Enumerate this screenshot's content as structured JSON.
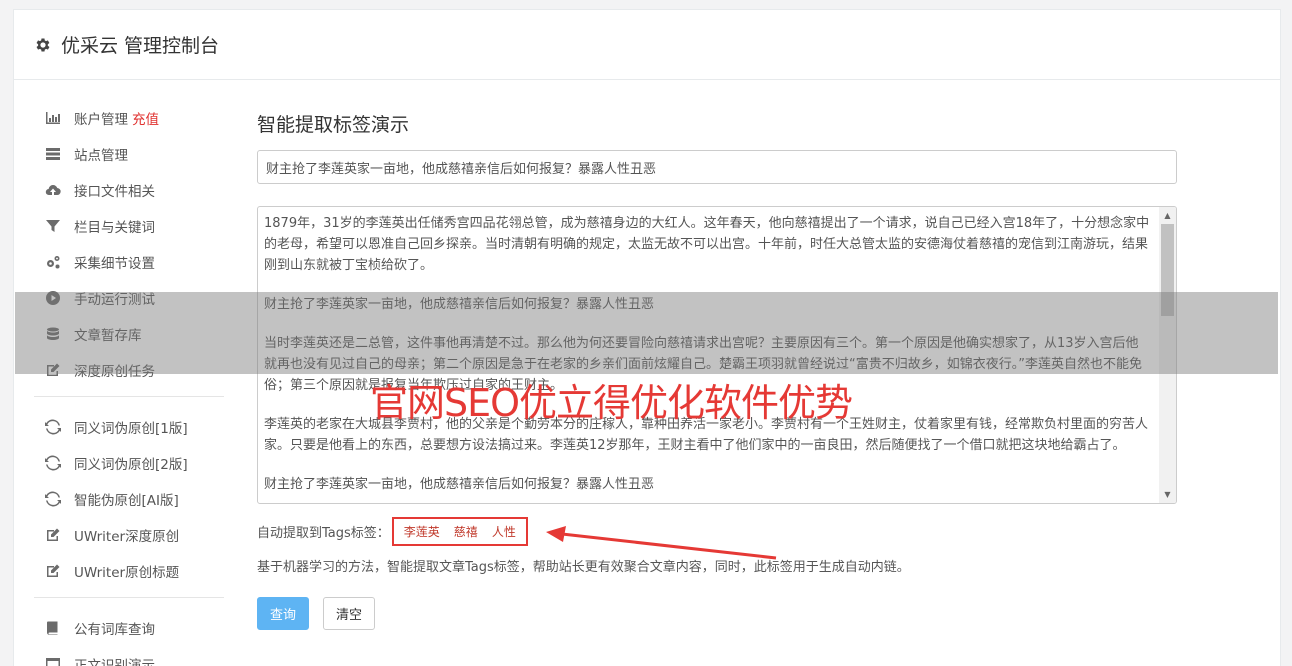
{
  "header": {
    "title": "优采云 管理控制台",
    "icon": "gear-icon"
  },
  "sidebar": {
    "group1": [
      {
        "label": "账户管理",
        "extra": "充值",
        "icon": "bar-chart-icon"
      },
      {
        "label": "站点管理",
        "icon": "server-icon"
      },
      {
        "label": "接口文件相关",
        "icon": "cloud-upload-icon"
      },
      {
        "label": "栏目与关键词",
        "icon": "filter-icon"
      },
      {
        "label": "采集细节设置",
        "icon": "gears-icon"
      },
      {
        "label": "手动运行测试",
        "icon": "play-icon"
      },
      {
        "label": "文章暂存库",
        "icon": "database-icon"
      },
      {
        "label": "深度原创任务",
        "icon": "edit-icon"
      }
    ],
    "group2": [
      {
        "label": "同义词伪原创[1版]",
        "icon": "refresh-icon"
      },
      {
        "label": "同义词伪原创[2版]",
        "icon": "refresh-icon"
      },
      {
        "label": "智能伪原创[AI版]",
        "icon": "refresh-icon"
      },
      {
        "label": "UWriter深度原创",
        "icon": "edit-icon"
      },
      {
        "label": "UWriter原创标题",
        "icon": "edit-icon"
      }
    ],
    "group3": [
      {
        "label": "公有词库查询",
        "icon": "book-icon"
      },
      {
        "label": "正文识别演示",
        "icon": "window-icon"
      }
    ]
  },
  "main": {
    "heading": "智能提取标签演示",
    "title_value": "财主抢了李莲英家一亩地，他成慈禧亲信后如何报复？暴露人性丑恶",
    "content_paragraphs": [
      "1879年，31岁的李莲英出任储秀宫四品花翎总管，成为慈禧身边的大红人。这年春天，他向慈禧提出了一个请求，说自己已经入宫18年了，十分想念家中的老母，希望可以恩准自己回乡探亲。当时清朝有明确的规定，太监无故不可以出宫。十年前，时任大总管太监的安德海仗着慈禧的宠信到江南游玩，结果刚到山东就被丁宝桢给砍了。",
      "财主抢了李莲英家一亩地，他成慈禧亲信后如何报复？暴露人性丑恶",
      "当时李莲英还是二总管，这件事他再清楚不过。那么他为何还要冒险向慈禧请求出宫呢？主要原因有三个。第一个原因是他确实想家了，从13岁入宫后他就再也没有见过自己的母亲；第二个原因是急于在老家的乡亲们面前炫耀自己。楚霸王项羽就曾经说过“富贵不归故乡，如锦衣夜行。”李莲英自然也不能免俗；第三个原因就是报复当年欺压过自家的王财主。",
      "李莲英的老家在大城县李贾村，他的父亲是个勤劳本分的庄稼人，靠种田养活一家老小。李贾村有一个王姓财主，仗着家里有钱，经常欺负村里面的穷苦人家。只要是他看上的东西，总要想方设法搞过来。李莲英12岁那年，王财主看中了他们家中的一亩良田，然后随便找了一个借口就把这块地给霸占了。",
      "财主抢了李莲英家一亩地，他成慈禧亲信后如何报复？暴露人性丑恶"
    ],
    "tags_label": "自动提取到Tags标签：",
    "tags": [
      "李莲英",
      "慈禧",
      "人性"
    ],
    "description": "基于机器学习的方法，智能提取文章Tags标签，帮助站长更有效聚合文章内容，同时，此标签用于生成自动内链。",
    "query_button": "查询",
    "clear_button": "清空"
  },
  "watermark": "官网SEO优立得优化软件优势",
  "colors": {
    "accent": "#5eb4f3",
    "highlight": "#e53935",
    "recharge": "#e0312f"
  }
}
